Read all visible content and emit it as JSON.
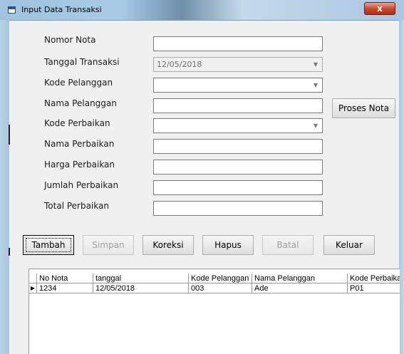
{
  "window": {
    "title": "Input Data Transaksi",
    "close_glyph": "x"
  },
  "form": {
    "nomor_nota": {
      "label": "Nomor Nota",
      "value": ""
    },
    "tanggal_transaksi": {
      "label": "Tanggal Transaksi",
      "value": "12/05/2018"
    },
    "kode_pelanggan": {
      "label": "Kode Pelanggan",
      "value": ""
    },
    "nama_pelanggan": {
      "label": "Nama Pelanggan",
      "value": ""
    },
    "kode_perbaikan": {
      "label": "Kode Perbaikan",
      "value": ""
    },
    "nama_perbaikan": {
      "label": "Nama Perbaikan",
      "value": ""
    },
    "harga_perbaikan": {
      "label": "Harga Perbaikan",
      "value": ""
    },
    "jumlah_perbaikan": {
      "label": "Jumlah Perbaikan",
      "value": ""
    },
    "total_perbaikan": {
      "label": "Total Perbaikan",
      "value": ""
    },
    "dropdown_arrow": "▼"
  },
  "buttons": {
    "proses_nota": "Proses Nota",
    "tambah": "Tambah",
    "simpan": "Simpan",
    "koreksi": "Koreksi",
    "hapus": "Hapus",
    "batal": "Batal",
    "keluar": "Keluar"
  },
  "grid": {
    "columns": [
      "No Nota",
      "tanggal",
      "Kode Pelanggan",
      "Nama Pelanggan",
      "Kode Perbaikan"
    ],
    "current_row_indicator": "▶",
    "rows": [
      [
        "1234",
        "12/05/2018",
        "003",
        "Ade",
        "P01"
      ]
    ]
  }
}
